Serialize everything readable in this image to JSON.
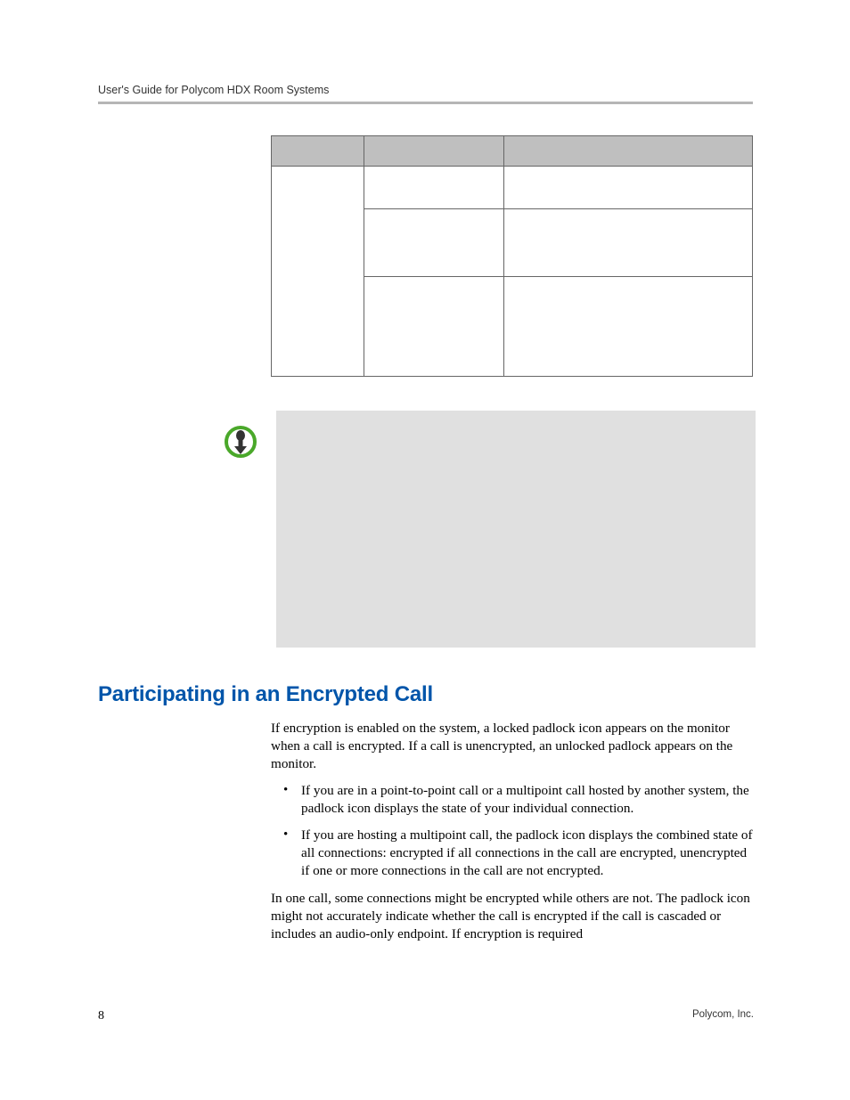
{
  "running_head": "User's Guide for Polycom HDX Room Systems",
  "heading": "Participating in an Encrypted Call",
  "para1": "If encryption is enabled on the system, a locked padlock icon appears on the monitor when a call is encrypted. If a call is unencrypted, an unlocked padlock appears on the monitor.",
  "bullet1": "If you are in a point-to-point call or a multipoint call hosted by another system, the padlock icon displays the state of your individual connection.",
  "bullet2": "If you are hosting a multipoint call, the padlock icon displays the combined state of all connections: encrypted if all connections in the call are encrypted, unencrypted if one or more connections in the call are not encrypted.",
  "para2": "In one call, some connections might be encrypted while others are not. The padlock icon might not accurately indicate whether the call is encrypted if the call is cascaded or includes an audio-only endpoint. If encryption is required",
  "page_number": "8",
  "footer_right": "Polycom, Inc."
}
